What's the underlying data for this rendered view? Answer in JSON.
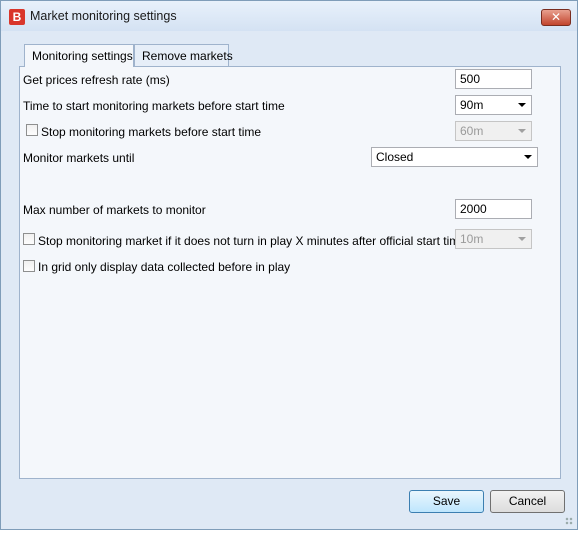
{
  "window": {
    "title": "Market monitoring settings",
    "app_icon_glyph": "B",
    "close_glyph": "✕"
  },
  "tabs": [
    {
      "label": "Monitoring settings",
      "active": true
    },
    {
      "label": "Remove markets",
      "active": false
    }
  ],
  "settings": {
    "refresh_rate_label": "Get prices refresh rate (ms)",
    "refresh_rate_value": "500",
    "start_monitoring_label": "Time to start monitoring markets before start time",
    "start_monitoring_value": "90m",
    "stop_before_label": "Stop monitoring markets before start time",
    "stop_before_checked": false,
    "stop_before_value": "60m",
    "monitor_until_label": "Monitor markets until",
    "monitor_until_value": "Closed",
    "max_markets_label": "Max number of markets to monitor",
    "max_markets_value": "2000",
    "stop_inplay_label": "Stop monitoring market if it does not turn in play X minutes after official start time",
    "stop_inplay_checked": false,
    "stop_inplay_value": "10m",
    "grid_only_label": "In grid only display data collected before in play",
    "grid_only_checked": false
  },
  "buttons": {
    "save": "Save",
    "cancel": "Cancel"
  }
}
